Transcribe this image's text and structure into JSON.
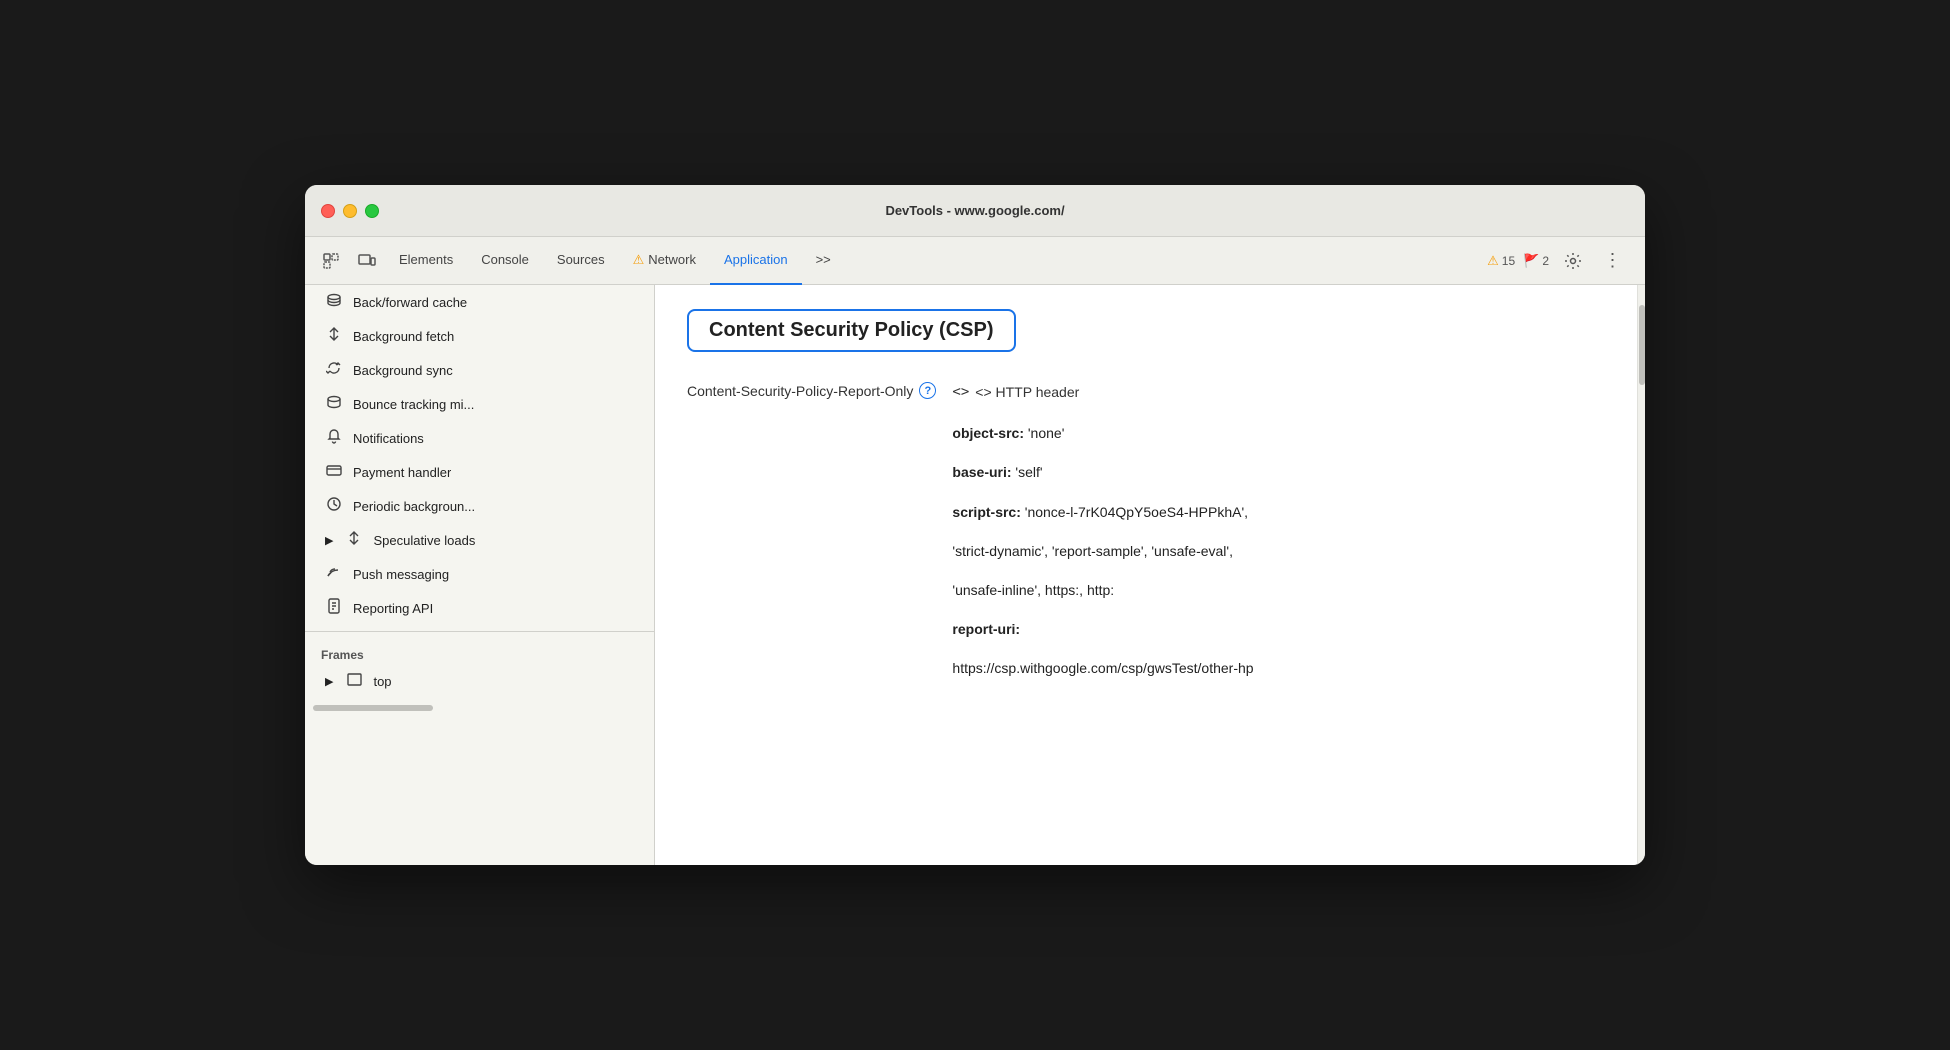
{
  "window": {
    "title": "DevTools - www.google.com/"
  },
  "toolbar": {
    "tabs": [
      {
        "id": "elements",
        "label": "Elements",
        "active": false,
        "warning": false
      },
      {
        "id": "console",
        "label": "Console",
        "active": false,
        "warning": false
      },
      {
        "id": "sources",
        "label": "Sources",
        "active": false,
        "warning": false
      },
      {
        "id": "network",
        "label": "Network",
        "active": false,
        "warning": true
      },
      {
        "id": "application",
        "label": "Application",
        "active": true,
        "warning": false
      }
    ],
    "more_tabs_label": ">>",
    "warn_count": "15",
    "error_count": "2",
    "settings_tooltip": "Settings",
    "more_menu_tooltip": "More options"
  },
  "sidebar": {
    "items": [
      {
        "id": "back-forward-cache",
        "label": "Back/forward cache",
        "icon": "🗄"
      },
      {
        "id": "background-fetch",
        "label": "Background fetch",
        "icon": "↕"
      },
      {
        "id": "background-sync",
        "label": "Background sync",
        "icon": "🔄"
      },
      {
        "id": "bounce-tracking",
        "label": "Bounce tracking mi...",
        "icon": "🗄"
      },
      {
        "id": "notifications",
        "label": "Notifications",
        "icon": "🔔"
      },
      {
        "id": "payment-handler",
        "label": "Payment handler",
        "icon": "💳"
      },
      {
        "id": "periodic-background",
        "label": "Periodic backgroun...",
        "icon": "🕐"
      },
      {
        "id": "speculative-loads",
        "label": "Speculative loads",
        "icon": "↕",
        "expandable": true
      },
      {
        "id": "push-messaging",
        "label": "Push messaging",
        "icon": "☁"
      },
      {
        "id": "reporting-api",
        "label": "Reporting API",
        "icon": "📄"
      }
    ],
    "frames_section": "Frames",
    "frames_top": "top"
  },
  "content": {
    "csp_title": "Content Security Policy (CSP)",
    "policy_label": "Content-Security-Policy-Report-Only",
    "http_header": "<> HTTP header",
    "object_src_key": "object-src:",
    "object_src_val": " 'none'",
    "base_uri_key": "base-uri:",
    "base_uri_val": " 'self'",
    "script_src_key": "script-src:",
    "script_src_val": " 'nonce-l-7rK04QpY5oeS4-HPPkhA',",
    "script_src_val2": " 'strict-dynamic', 'report-sample', 'unsafe-eval',",
    "script_src_val3": " 'unsafe-inline', https:, http:",
    "report_uri_key": "report-uri:",
    "report_uri_val": "https://csp.withgoogle.com/csp/gwsTest/other-hp"
  }
}
